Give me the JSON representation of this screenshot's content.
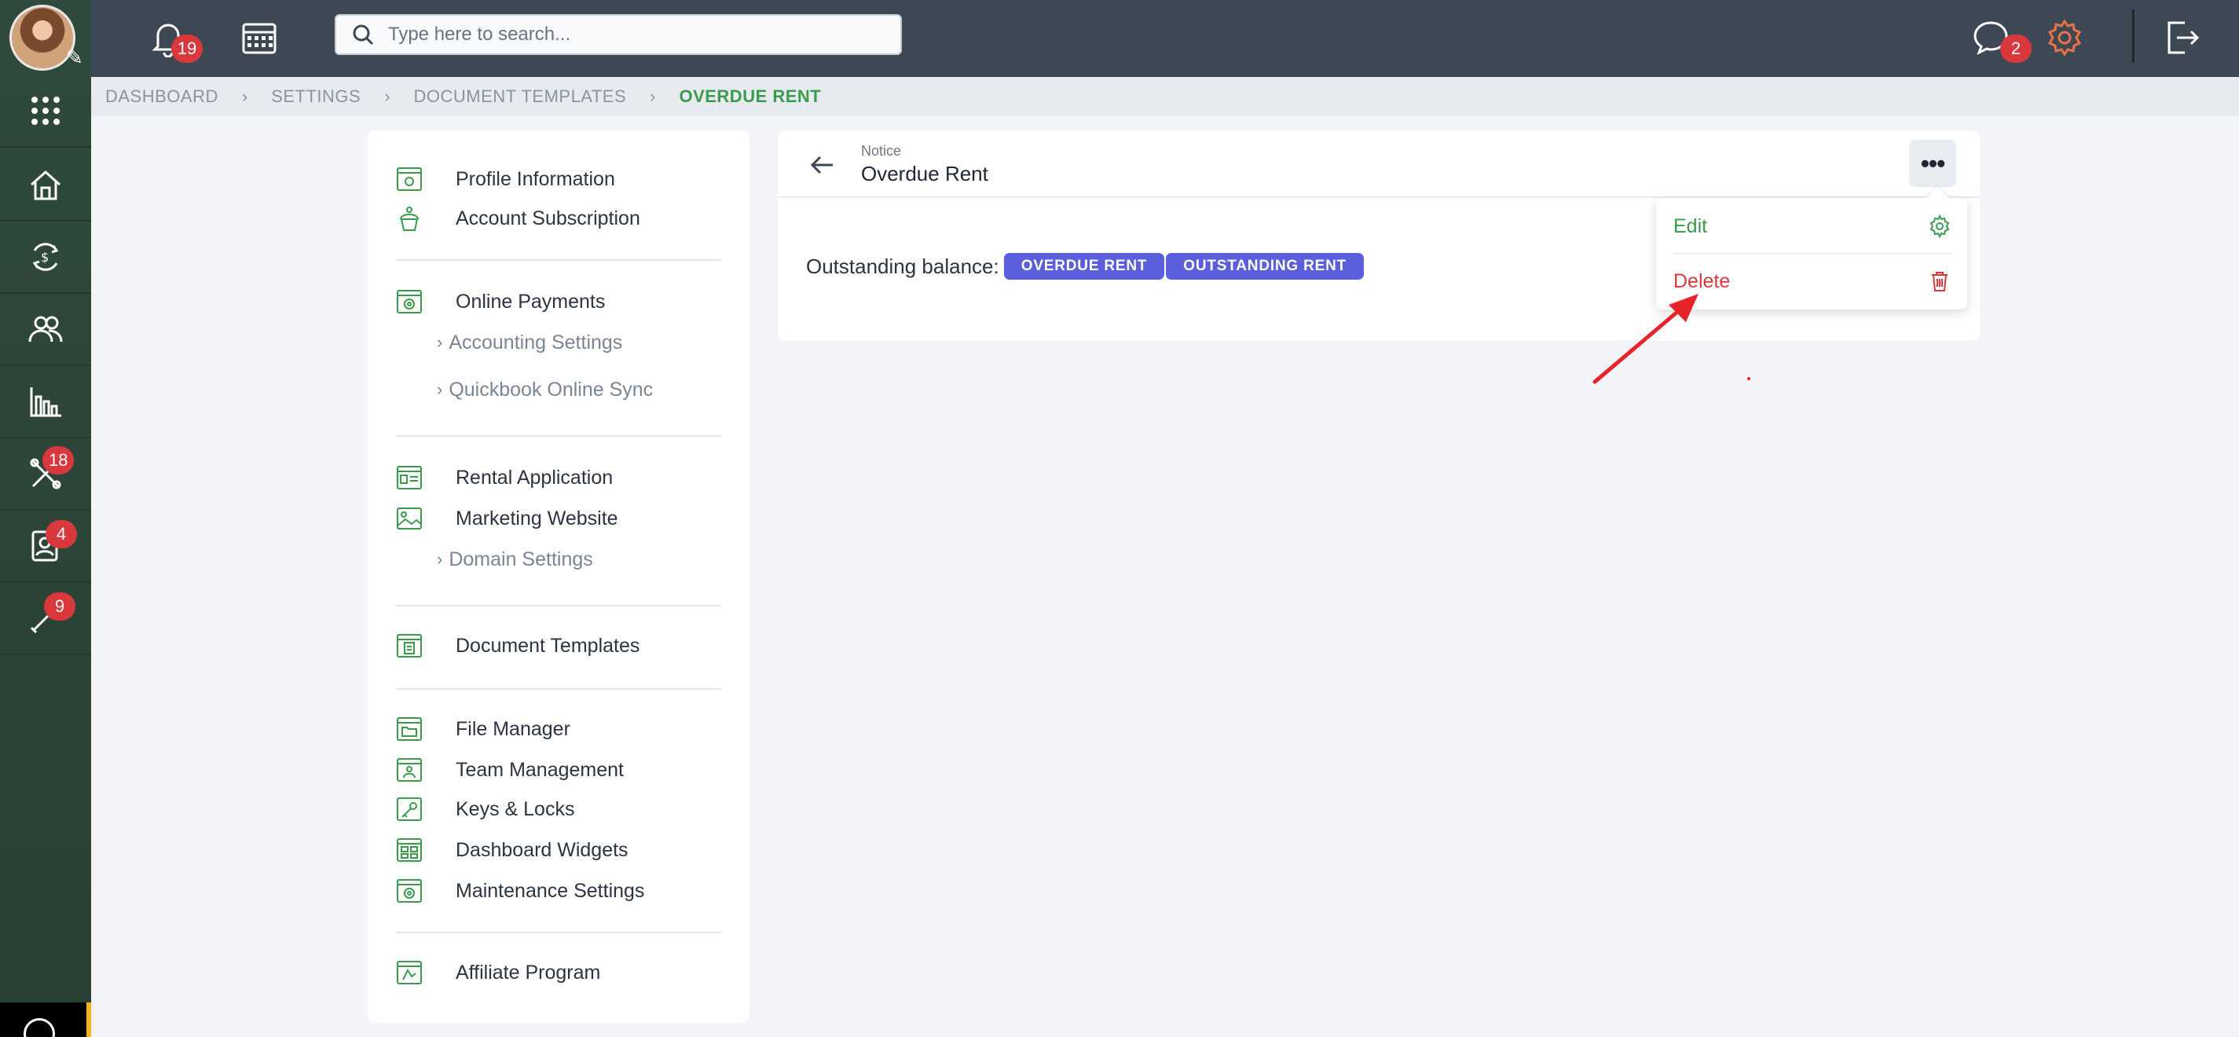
{
  "topbar": {
    "notifications_count": "19",
    "messages_count": "2",
    "search_placeholder": "Type here to search..."
  },
  "rail": {
    "badges": {
      "maintenance": "18",
      "tenants": "4",
      "vendors": "9"
    }
  },
  "breadcrumb": {
    "items": [
      "DASHBOARD",
      "SETTINGS",
      "DOCUMENT TEMPLATES"
    ],
    "active": "OVERDUE RENT"
  },
  "menu": {
    "profile": "Profile Information",
    "subscription": "Account Subscription",
    "payments": "Online Payments",
    "accounting": "Accounting Settings",
    "quickbook": "Quickbook Online Sync",
    "rental_app": "Rental Application",
    "marketing": "Marketing Website",
    "domain": "Domain Settings",
    "doc_templates": "Document Templates",
    "file_manager": "File Manager",
    "team": "Team Management",
    "keys": "Keys & Locks",
    "widgets": "Dashboard Widgets",
    "maintenance": "Maintenance Settings",
    "affiliate": "Affiliate Program"
  },
  "content": {
    "label": "Notice",
    "title": "Overdue Rent",
    "more": "•••",
    "balance_label": "Outstanding balance:",
    "tags": [
      "OVERDUE RENT",
      "OUTSTANDING RENT"
    ]
  },
  "dropdown": {
    "edit": "Edit",
    "delete": "Delete"
  },
  "colors": {
    "accent_green": "#3a9b4c",
    "danger_red": "#d9393c",
    "tag_purple": "#5b5fdc",
    "topbar": "#3d4854",
    "rail": "#2f4a3c"
  }
}
